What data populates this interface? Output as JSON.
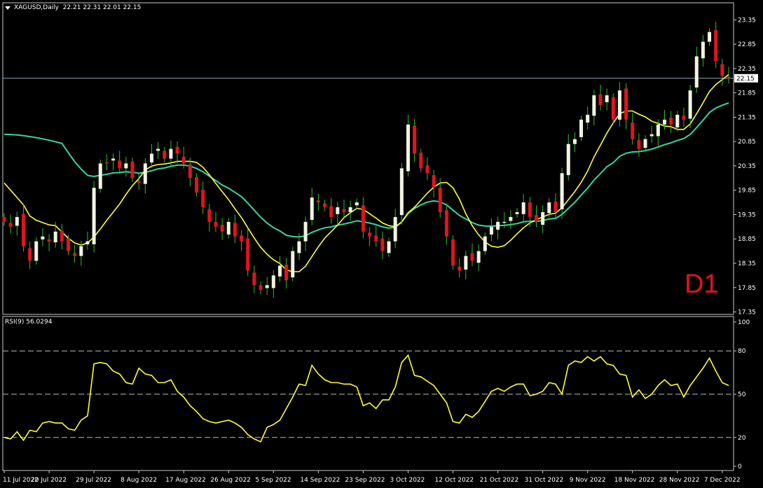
{
  "header": {
    "symbol_info": "XAGUSD,Daily  22.21 22.31 22.01 22.15",
    "timeframe_label": "D1"
  },
  "rsi_panel": {
    "title": "RSI(9) 56.0294",
    "levels": [
      20,
      50,
      80
    ],
    "scale_labels": [
      "100",
      "80",
      "50",
      "20",
      "0"
    ]
  },
  "colors": {
    "background": "#000000",
    "bull_candle": "#f0f5e1",
    "bear_candle": "#e0141e",
    "wick": "#2fbf2f",
    "ma_fast": "#ffff33",
    "ma_slow": "#33d6a2",
    "rsi_line": "#ffff33",
    "price_line": "#8fa7b3",
    "grid_frame": "#c8c8c8"
  },
  "chart_data": [
    {
      "type": "candlestick",
      "title": "XAGUSD,Daily",
      "y_ticks": [
        "23.35",
        "22.85",
        "22.35",
        "21.85",
        "21.35",
        "20.85",
        "20.35",
        "19.85",
        "19.35",
        "18.85",
        "18.35",
        "17.85",
        "17.35"
      ],
      "ylim": [
        17.3,
        23.7
      ],
      "current_price": "22.15",
      "x_ticks": [
        {
          "i": 0,
          "label": "11 Jul 2022"
        },
        {
          "i": 7,
          "label": "20 Jul 2022"
        },
        {
          "i": 14,
          "label": "29 Jul 2022"
        },
        {
          "i": 21,
          "label": "8 Aug 2022"
        },
        {
          "i": 28,
          "label": "17 Aug 2022"
        },
        {
          "i": 35,
          "label": "26 Aug 2022"
        },
        {
          "i": 42,
          "label": "5 Sep 2022"
        },
        {
          "i": 49,
          "label": "14 Sep 2022"
        },
        {
          "i": 56,
          "label": "23 Sep 2022"
        },
        {
          "i": 63,
          "label": "3 Oct 2022"
        },
        {
          "i": 70,
          "label": "12 Oct 2022"
        },
        {
          "i": 77,
          "label": "21 Oct 2022"
        },
        {
          "i": 84,
          "label": "31 Oct 2022"
        },
        {
          "i": 91,
          "label": "9 Nov 2022"
        },
        {
          "i": 98,
          "label": "18 Nov 2022"
        },
        {
          "i": 105,
          "label": "28 Nov 2022"
        },
        {
          "i": 112,
          "label": "7 Dec 2022"
        }
      ],
      "closes": [
        19.2,
        19.1,
        19.3,
        18.7,
        18.4,
        18.8,
        18.9,
        18.8,
        19.0,
        18.8,
        18.6,
        18.5,
        18.7,
        18.8,
        19.9,
        20.4,
        20.4,
        20.5,
        20.3,
        20.4,
        20.1,
        20.0,
        20.4,
        20.6,
        20.7,
        20.5,
        20.7,
        20.6,
        20.4,
        20.1,
        19.8,
        19.5,
        19.2,
        19.1,
        19.0,
        19.2,
        18.9,
        18.8,
        18.2,
        17.9,
        17.8,
        17.9,
        18.1,
        18.3,
        18.0,
        18.6,
        18.8,
        19.2,
        19.7,
        19.6,
        19.5,
        19.3,
        19.5,
        19.4,
        19.5,
        19.6,
        19.0,
        18.9,
        18.8,
        18.6,
        18.8,
        19.3,
        20.3,
        21.2,
        20.6,
        20.3,
        20.2,
        19.9,
        19.4,
        18.9,
        18.3,
        18.2,
        18.5,
        18.4,
        18.6,
        18.9,
        19.1,
        19.2,
        19.2,
        19.3,
        19.4,
        19.6,
        19.3,
        19.2,
        19.4,
        19.6,
        19.4,
        20.2,
        20.8,
        20.9,
        21.3,
        21.4,
        21.8,
        21.6,
        21.8,
        21.3,
        21.9,
        21.3,
        20.9,
        20.7,
        20.9,
        21.0,
        21.2,
        21.3,
        21.2,
        21.4,
        21.3,
        21.9,
        22.6,
        22.9,
        23.1,
        22.5,
        22.2,
        22.15
      ]
    },
    {
      "type": "line",
      "title": "RSI(9) 56.0294",
      "ylim": [
        0,
        100
      ],
      "y_ticks": [
        "100",
        "80",
        "50",
        "20",
        "0"
      ],
      "values": [
        20,
        19,
        24,
        18,
        25,
        24,
        30,
        31,
        30,
        30,
        26,
        25,
        32,
        35,
        71,
        72,
        71,
        66,
        64,
        58,
        57,
        68,
        64,
        63,
        58,
        58,
        60,
        52,
        48,
        42,
        38,
        33,
        31,
        30,
        31,
        32,
        30,
        27,
        22,
        19,
        17,
        27,
        29,
        32,
        40,
        48,
        57,
        56,
        70,
        64,
        60,
        58,
        58,
        57,
        57,
        55,
        42,
        44,
        40,
        46,
        46,
        55,
        72,
        77,
        63,
        62,
        59,
        56,
        50,
        44,
        31,
        30,
        36,
        34,
        38,
        45,
        52,
        54,
        52,
        55,
        57,
        57,
        49,
        50,
        52,
        58,
        57,
        50,
        70,
        73,
        72,
        76,
        73,
        76,
        71,
        70,
        64,
        63,
        48,
        53,
        47,
        50,
        56,
        60,
        56,
        57,
        48,
        56,
        62,
        68,
        75,
        66,
        58,
        56
      ]
    }
  ]
}
